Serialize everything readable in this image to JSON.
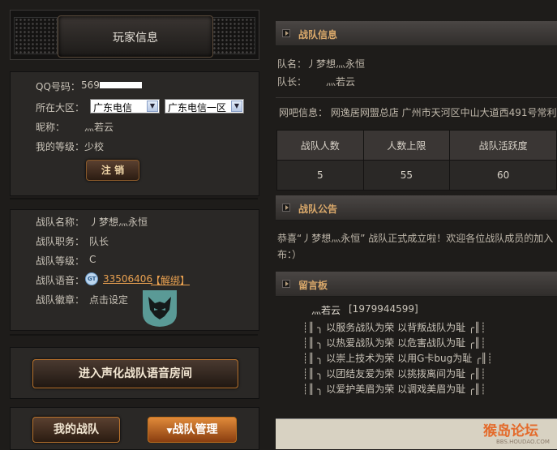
{
  "left": {
    "title": "玩家信息",
    "player": {
      "qq_label": "QQ号码：",
      "qq_value": "569",
      "region_label": "所在大区：",
      "region_select": "广东电信",
      "server_select": "广东电信一区",
      "nickname_label": "昵称：",
      "nickname_value": "灬若云",
      "level_label": "我的等级：",
      "level_value": "少校",
      "logout_button": "注 销"
    },
    "team": {
      "name_label": "战队名称：",
      "name_value": "丿梦想灬永恒",
      "role_label": "战队职务：",
      "role_value": "队长",
      "grade_label": "战队等级：",
      "grade_value": "C",
      "voice_label": "战队语音：",
      "voice_number": "33506406",
      "unbind_link": "【解绑】",
      "emblem_label": "战队徽章：",
      "emblem_link": "点击设定"
    },
    "enter_voice_button": "进入声化战队语音房间",
    "my_team_button": "我的战队",
    "team_manage_button": "战队管理"
  },
  "right": {
    "team_info": {
      "header": "战队信息",
      "name_line": "队名：丿梦想灬永恒",
      "leader_label": "队长：",
      "leader_value": "灬若云",
      "cafe_line": "网吧信息： 网逸居网盟总店 广州市天河区中山大道西491号常利",
      "stats": {
        "headers": [
          "战队人数",
          "人数上限",
          "战队活跃度"
        ],
        "values": [
          "5",
          "55",
          "60"
        ]
      }
    },
    "notice": {
      "header": "战队公告",
      "line1": "恭喜“丿梦想灬永恒” 战队正式成立啦！欢迎各位战队成员的加入",
      "line2": "布：）"
    },
    "board": {
      "header": "留言板",
      "author": "灬若云",
      "author_qq": "[1979944599]",
      "lines": [
        "┊║ ╮ 以服务战队为荣 以背叛战队为耻 ╭║┊",
        "┊║ ╮ 以热爱战队为荣 以危害战队为耻 ╭║┊",
        "┊║ ╮ 以崇上技术为荣 以用G卡bug为耻 ╭║┊",
        "┊║ ╮ 以团结友爱为荣 以挑拨离间为耻 ╭║┊",
        "┊║ ╮ 以爱护美眉为荣 以调戏美眉为耻 ╭║┊"
      ]
    },
    "watermark": "猴岛论坛",
    "watermark_url": "BBS.HOUDAO.COM"
  },
  "colors": {
    "background": "#1e1c1a",
    "header_text": "#d9a86a",
    "link_orange": "#e8a050",
    "emblem_teal": "#5a9a96"
  }
}
